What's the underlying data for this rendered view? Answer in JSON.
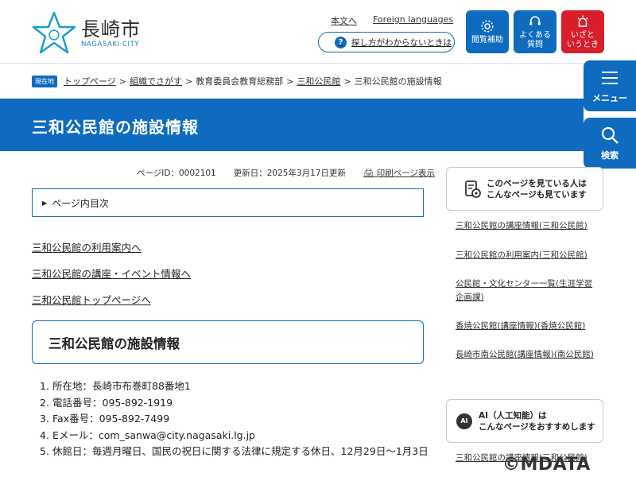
{
  "header": {
    "logo_text": "長崎市",
    "logo_sub": "NAGASAKI CITY",
    "link_main_text": "本文へ",
    "link_foreign": "Foreign languages",
    "howto": "探し方がわからないときは",
    "btn_accessibility": [
      "閲覧補助"
    ],
    "btn_faq": [
      "よくある",
      "質問"
    ],
    "btn_emergency": [
      "いざと",
      "いうとき"
    ]
  },
  "side": {
    "menu": "メニュー",
    "search": "検索"
  },
  "breadcrumb": {
    "badge": "現在地",
    "items": [
      "トップページ",
      "組織でさがす",
      "教育委員会教育総務部",
      "三和公民館",
      "三和公民館の施設情報"
    ]
  },
  "page": {
    "title": "三和公民館の施設情報",
    "page_id": "ページID：0002101",
    "updated": "更新日：2025年3月17日更新",
    "print": "印刷ページ表示",
    "toc": "ページ内目次",
    "links": [
      "三和公民館の利用案内へ",
      "三和公民館の講座・イベント情報へ",
      "三和公民館トップページへ"
    ],
    "section_title": "三和公民館の施設情報",
    "info": [
      "所在地：長崎市布巻町88番地1",
      "電話番号：095-892-1919",
      "Fax番号：095-892-7499",
      "Eメール：com_sanwa@city.nagasaki.lg.jp",
      "休館日：毎週月曜日、国民の祝日に関する法律に規定する休日、12月29日～1月3日"
    ]
  },
  "sidebar": {
    "related_title": [
      "このページを見ている人は",
      "こんなページも見ています"
    ],
    "related_links": [
      "三和公民館の講座情報(三和公民館)",
      "三和公民館の利用案内(三和公民館)",
      "公民館・文化センター一覧(生涯学習企画課)",
      "香焼公民館(講座情報)(香焼公民館)",
      "長崎市南公民館(講座情報)(南公民館)"
    ],
    "ai_badge": "AI",
    "ai_title": [
      "AI（人工知能）は",
      "こんなページをおすすめします"
    ],
    "ai_links": [
      "三和公民館の講座情報(三和公民館)"
    ]
  },
  "watermark": "©MDATA",
  "colors": {
    "primary": "#0e6bbf",
    "emergency": "#d81e2a"
  }
}
